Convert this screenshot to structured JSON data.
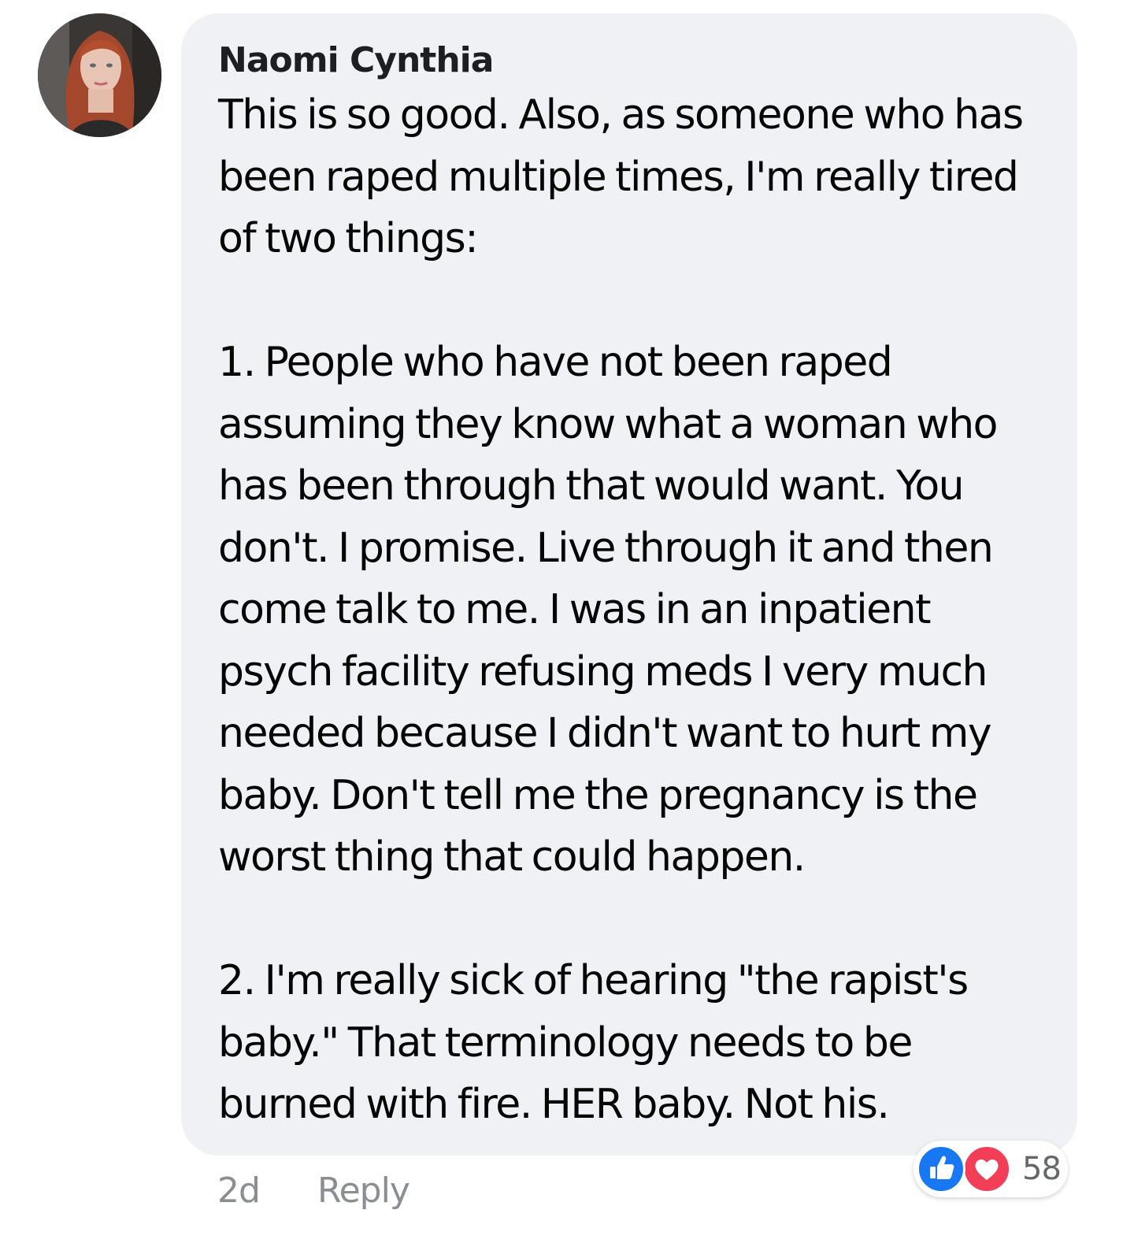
{
  "comment": {
    "author": "Naomi Cynthia",
    "lines": [
      "This is so good. Also, as someone who has",
      "been raped multiple times, I'm really tired",
      "of two things:",
      "",
      "1. People who have not been raped",
      "assuming they know what a woman who",
      "has been through that would want. You",
      "don't. I promise. Live through it and then",
      "come talk to me. I was in an inpatient",
      "psych facility refusing meds I very much",
      "needed because I didn't want to hurt my",
      "baby. Don't tell me the pregnancy is the",
      "worst thing that could happen.",
      "",
      "2. I'm really sick of hearing \"the rapist's",
      "baby.\" That terminology needs to be",
      "burned with fire. HER baby. Not his."
    ],
    "timestamp": "2d",
    "reply_label": "Reply",
    "reactions": {
      "icons": [
        "like-icon",
        "love-icon"
      ],
      "count": "58"
    }
  },
  "colors": {
    "bubble_bg": "#f0f1f4",
    "text": "#050505",
    "meta_text": "#8a8d91",
    "like_blue": "#1877f2",
    "love_red": "#f33e58"
  }
}
